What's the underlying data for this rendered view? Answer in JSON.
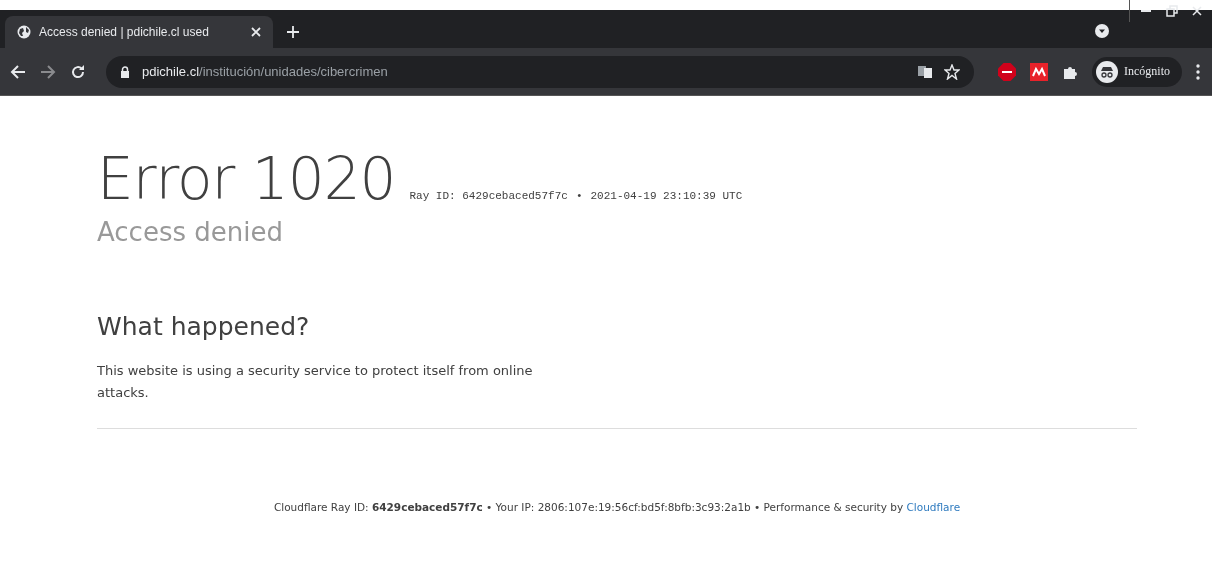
{
  "browser": {
    "tab": {
      "title": "Access denied | pdichile.cl used",
      "selected": true
    },
    "address": {
      "host": "pdichile.cl",
      "path": "/institución/unidades/cibercrimen"
    },
    "profile": {
      "label": "Incógnito"
    }
  },
  "error": {
    "title": "Error 1020",
    "ray": "Ray ID: 6429cebaced57f7c",
    "separator": "•",
    "time": "2021-04-19 23:10:39 UTC",
    "subtitle": "Access denied"
  },
  "section": {
    "heading": "What happened?",
    "text": "This website is using a security service to protect itself from online attacks."
  },
  "footer": {
    "text": "Cloudflare Ray ID: **6429cebaced57f7c** • Your IP: 2806:107e:19:56cf:bd5f:8bfb:3c93:2a1b • Performance & security by ",
    "link": "Cloudflare"
  }
}
